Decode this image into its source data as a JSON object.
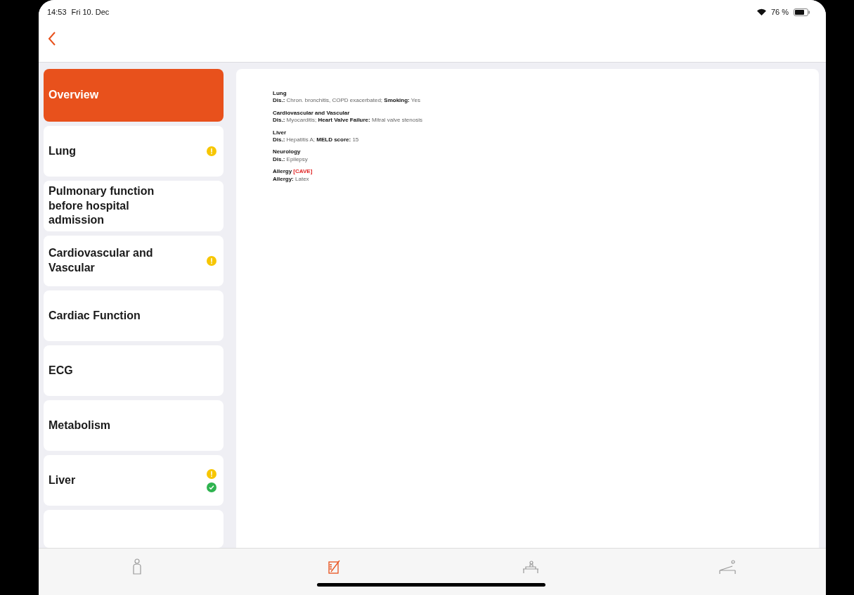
{
  "status_bar": {
    "time": "14:53",
    "date": "Fri 10. Dec",
    "battery": "76 %"
  },
  "sidebar": {
    "items": [
      {
        "label": "Overview",
        "selected": true,
        "warning": false,
        "done": false
      },
      {
        "label": "Lung",
        "selected": false,
        "warning": true,
        "done": false
      },
      {
        "label": "Pulmonary function before hospital admission",
        "selected": false,
        "warning": false,
        "done": false
      },
      {
        "label": "Cardiovascular and Vascular",
        "selected": false,
        "warning": true,
        "done": false
      },
      {
        "label": "Cardiac Function",
        "selected": false,
        "warning": false,
        "done": false
      },
      {
        "label": "ECG",
        "selected": false,
        "warning": false,
        "done": false
      },
      {
        "label": "Metabolism",
        "selected": false,
        "warning": false,
        "done": false
      },
      {
        "label": "Liver",
        "selected": false,
        "warning": true,
        "done": true
      }
    ]
  },
  "overview": {
    "sections": [
      {
        "title": "Lung",
        "detail": "**Dis.:** Chron. bronchitis, COPD exacerbated; **Smoking:** Yes"
      },
      {
        "title": "Cardiovascular and Vascular",
        "detail": "**Dis.:** Myocarditis; **Heart Valve Failure:** Mitral valve stenosis"
      },
      {
        "title": "Liver",
        "detail": "**Dis.:** Hepatitis A; **MELD score:** 15"
      },
      {
        "title": "Neurology",
        "detail": "**Dis.:** Epilepsy"
      },
      {
        "title": "Allergy",
        "tag": "[CAVE]",
        "detail": "**Allergy:** Latex"
      }
    ]
  },
  "tab_bar": [
    {
      "kind": "person",
      "selected": false
    },
    {
      "kind": "notes",
      "selected": true
    },
    {
      "kind": "exam",
      "selected": false
    },
    {
      "kind": "recliner",
      "selected": false
    }
  ]
}
